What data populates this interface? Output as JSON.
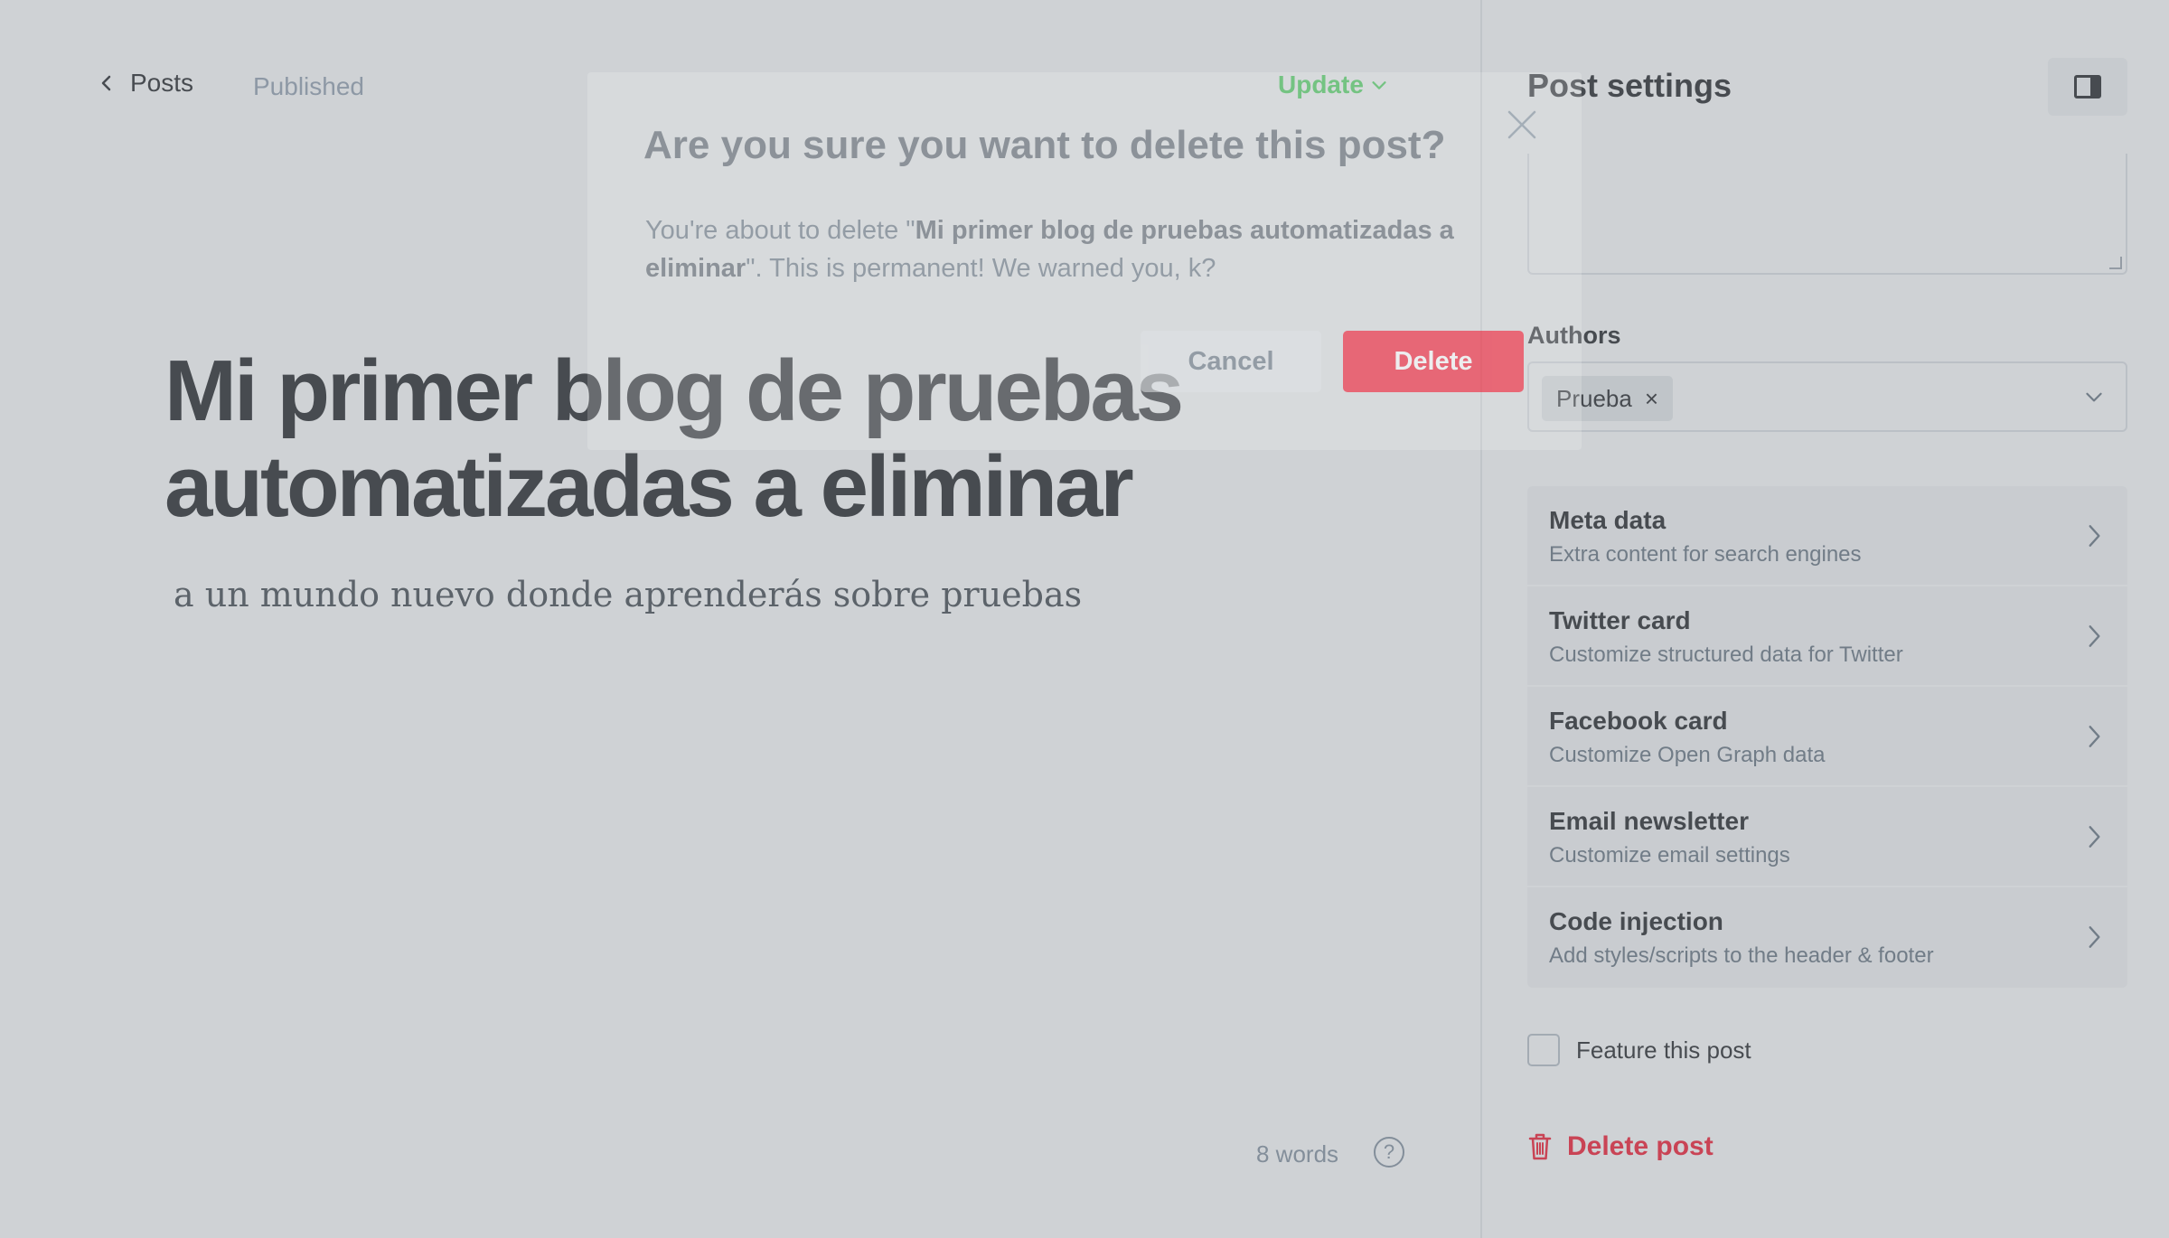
{
  "topbar": {
    "back_label": "Posts",
    "status": "Published",
    "update_label": "Update"
  },
  "post": {
    "title": "Mi primer blog de pruebas automatizadas a eliminar",
    "excerpt": "a un mundo nuevo donde aprenderás sobre pruebas",
    "word_count": "8 words",
    "help_glyph": "?"
  },
  "sidebar": {
    "title": "Post settings",
    "authors_label": "Authors",
    "authors": [
      {
        "name": "Prueba",
        "remove_glyph": "×"
      }
    ],
    "items": [
      {
        "title": "Meta data",
        "description": "Extra content for search engines"
      },
      {
        "title": "Twitter card",
        "description": "Customize structured data for Twitter"
      },
      {
        "title": "Facebook card",
        "description": "Customize Open Graph data"
      },
      {
        "title": "Email newsletter",
        "description": "Customize email settings"
      },
      {
        "title": "Code injection",
        "description": "Add styles/scripts to the header & footer"
      }
    ],
    "feature_label": "Feature this post",
    "delete_label": "Delete post"
  },
  "modal": {
    "title": "Are you sure you want to delete this post?",
    "body_prefix": "You're about to delete \"",
    "body_post_title": "Mi primer blog de pruebas automatizadas a eliminar",
    "body_suffix": "\". This is permanent! We warned you, k?",
    "cancel_label": "Cancel",
    "delete_label": "Delete"
  },
  "colors": {
    "accent_green": "#30cf43",
    "danger_red": "#f50b23",
    "text_dark": "#15171a",
    "text_muted": "#8e9cac"
  },
  "icons": {
    "back": "chevron-left-icon",
    "update_dropdown": "chevron-down-icon",
    "help": "question-circle-icon",
    "sidebar_toggle": "sidebar-panel-icon",
    "author_select": "chevron-down-icon",
    "item_chevron": "chevron-right-icon",
    "delete": "trash-icon",
    "modal_close": "close-icon"
  }
}
